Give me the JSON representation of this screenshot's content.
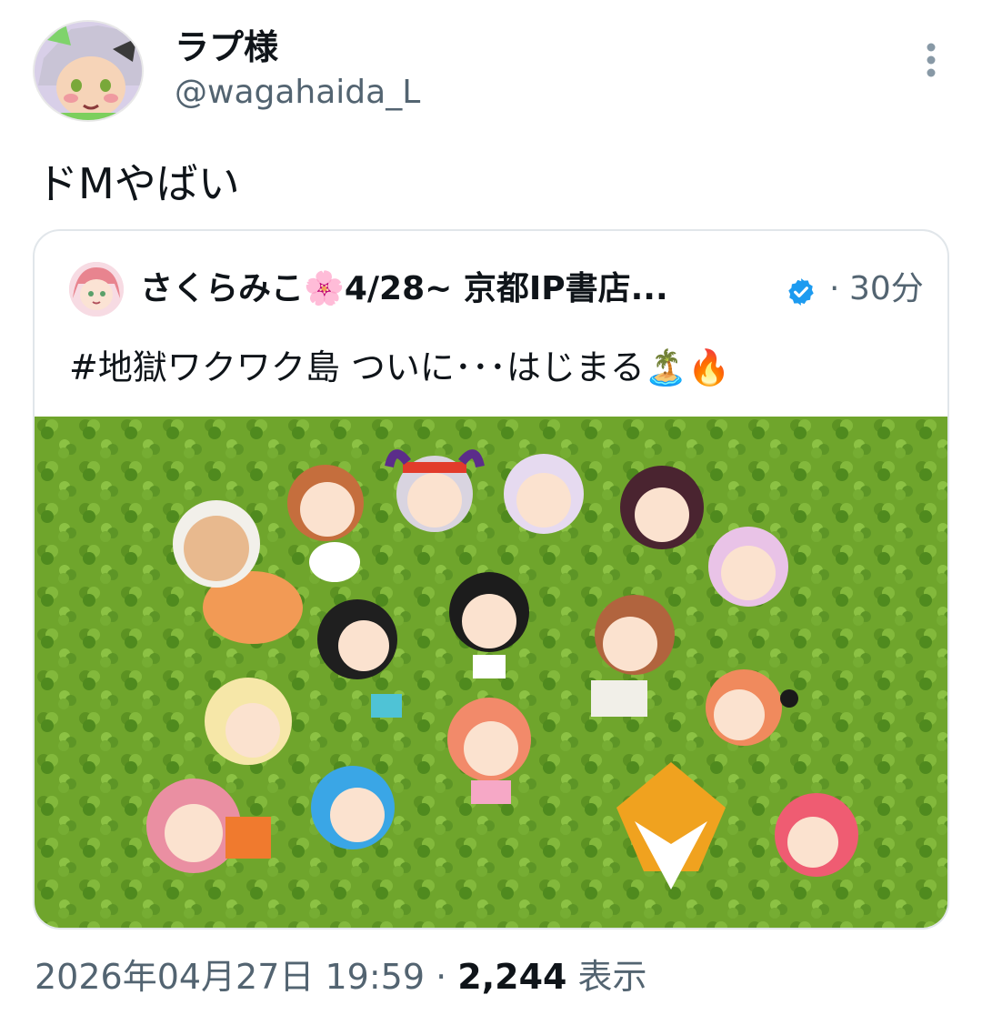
{
  "author": {
    "display_name": "ラプ様",
    "handle": "@wagahaida_L"
  },
  "tweet": {
    "text": "ドMやばい"
  },
  "quoted": {
    "name": "さくらみこ🌸4/28~ 京都IP書店...",
    "dot": "·",
    "time": "30分",
    "text": "#地獄ワクワク島 ついに･･･はじまる🏝️🔥"
  },
  "footer": {
    "datetime": "2026年04月27日 19:59",
    "sep": " · ",
    "views_count": "2,244",
    "views_label": " 表示"
  },
  "colors": {
    "text": "#0f1419",
    "secondary": "#536471",
    "verified": "#1d9bf0",
    "grass": "#6fa52c"
  },
  "icons": {
    "more": "more-vertical-icon",
    "verified": "verified-badge-icon"
  }
}
